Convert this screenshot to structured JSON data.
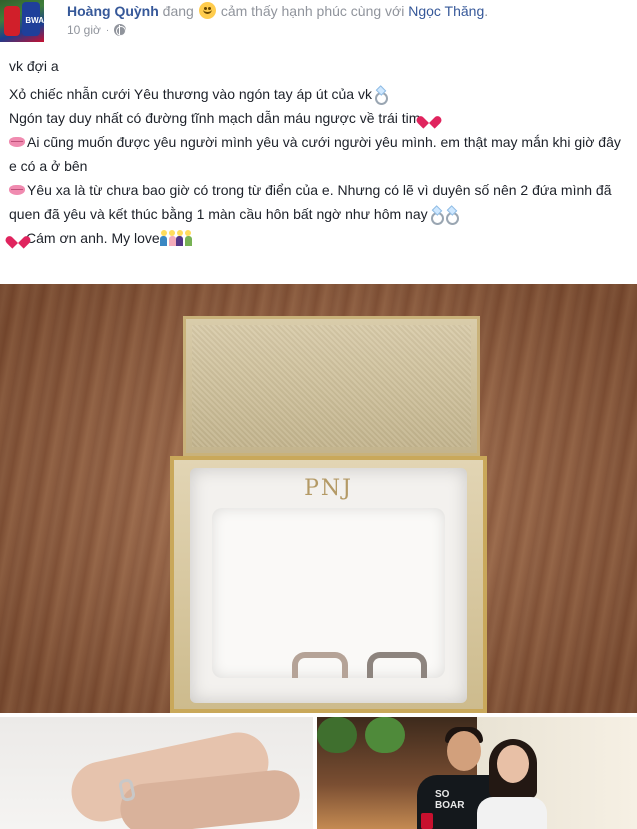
{
  "post": {
    "author": "Hoàng Quỳnh",
    "feeling_prefix": "đang",
    "feeling": "cảm thấy hạnh phúc cùng với",
    "tagged": "Ngọc Thăng",
    "time": "10 giờ",
    "dot": "·",
    "privacy_icon": "globe-icon",
    "avatar_tag": "BWA"
  },
  "text": {
    "line1": "vk đợi a",
    "line2": "Xỏ chiếc nhẫn cưới Yêu thương vào ngón tay áp út của vk",
    "line3": "Ngón tay duy nhất có đường tĩnh mạch dẫn máu ngược về trái tim",
    "line4": "Ai cũng muốn được yêu người mình yêu và cưới người yêu mình. em thật may mắn khi giờ đây e có a ở bên",
    "line5": "Yêu xa là từ chưa bao giờ có trong từ điển của e. Nhưng có lẽ vì duyên số nên 2 đứa mình đã quen đã yêu và kết thúc bằng 1 màn cầu hôn bất ngờ như hôm nay",
    "line6": "Cám ơn anh. My love"
  },
  "photos": {
    "main_brand": "PNJ",
    "shirt_text_line1": "SO",
    "shirt_text_line2": "BOAR"
  },
  "colors": {
    "link": "#365899",
    "meta": "#90949c",
    "text": "#1d2129"
  }
}
